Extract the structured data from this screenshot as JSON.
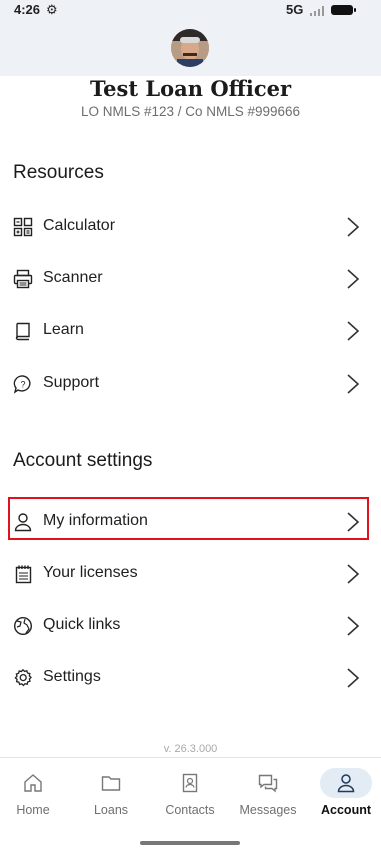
{
  "status_bar": {
    "time": "4:26",
    "network": "5G"
  },
  "profile": {
    "name": "Test Loan Officer",
    "nmls": "LO NMLS #123 / Co NMLS #999666"
  },
  "resources": {
    "title": "Resources",
    "items": [
      {
        "label": "Calculator",
        "icon": "calculator-icon"
      },
      {
        "label": "Scanner",
        "icon": "printer-icon"
      },
      {
        "label": "Learn",
        "icon": "book-icon"
      },
      {
        "label": "Support",
        "icon": "support-chat-icon"
      }
    ]
  },
  "account_settings": {
    "title": "Account settings",
    "items": [
      {
        "label": "My information",
        "icon": "user-icon"
      },
      {
        "label": "Your licenses",
        "icon": "license-icon"
      },
      {
        "label": "Quick links",
        "icon": "globe-icon"
      },
      {
        "label": "Settings",
        "icon": "gear-icon"
      }
    ]
  },
  "version": "v. 26.3.000",
  "bottom_nav": {
    "items": [
      {
        "label": "Home",
        "icon": "home-icon"
      },
      {
        "label": "Loans",
        "icon": "folder-icon"
      },
      {
        "label": "Contacts",
        "icon": "contacts-icon"
      },
      {
        "label": "Messages",
        "icon": "messages-icon"
      },
      {
        "label": "Account",
        "icon": "account-icon"
      }
    ],
    "active": "Account"
  },
  "colors": {
    "highlight": "#e0121b",
    "status_bg": "#eef1f6",
    "active_pill": "#e3ebf5"
  }
}
